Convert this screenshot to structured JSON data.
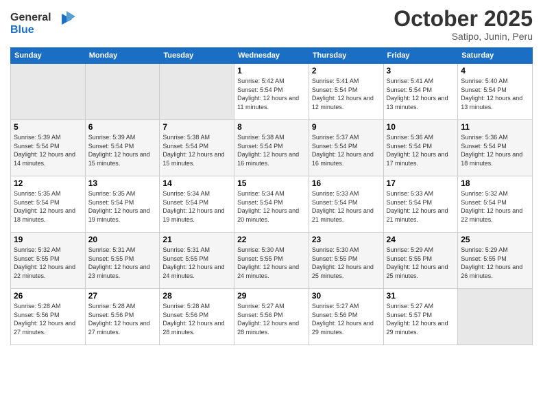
{
  "header": {
    "logo_line1": "General",
    "logo_line2": "Blue",
    "month_title": "October 2025",
    "location": "Satipo, Junin, Peru"
  },
  "weekdays": [
    "Sunday",
    "Monday",
    "Tuesday",
    "Wednesday",
    "Thursday",
    "Friday",
    "Saturday"
  ],
  "weeks": [
    [
      {
        "day": "",
        "sunrise": "",
        "sunset": "",
        "daylight": ""
      },
      {
        "day": "",
        "sunrise": "",
        "sunset": "",
        "daylight": ""
      },
      {
        "day": "",
        "sunrise": "",
        "sunset": "",
        "daylight": ""
      },
      {
        "day": "1",
        "sunrise": "Sunrise: 5:42 AM",
        "sunset": "Sunset: 5:54 PM",
        "daylight": "Daylight: 12 hours and 11 minutes."
      },
      {
        "day": "2",
        "sunrise": "Sunrise: 5:41 AM",
        "sunset": "Sunset: 5:54 PM",
        "daylight": "Daylight: 12 hours and 12 minutes."
      },
      {
        "day": "3",
        "sunrise": "Sunrise: 5:41 AM",
        "sunset": "Sunset: 5:54 PM",
        "daylight": "Daylight: 12 hours and 13 minutes."
      },
      {
        "day": "4",
        "sunrise": "Sunrise: 5:40 AM",
        "sunset": "Sunset: 5:54 PM",
        "daylight": "Daylight: 12 hours and 13 minutes."
      }
    ],
    [
      {
        "day": "5",
        "sunrise": "Sunrise: 5:39 AM",
        "sunset": "Sunset: 5:54 PM",
        "daylight": "Daylight: 12 hours and 14 minutes."
      },
      {
        "day": "6",
        "sunrise": "Sunrise: 5:39 AM",
        "sunset": "Sunset: 5:54 PM",
        "daylight": "Daylight: 12 hours and 15 minutes."
      },
      {
        "day": "7",
        "sunrise": "Sunrise: 5:38 AM",
        "sunset": "Sunset: 5:54 PM",
        "daylight": "Daylight: 12 hours and 15 minutes."
      },
      {
        "day": "8",
        "sunrise": "Sunrise: 5:38 AM",
        "sunset": "Sunset: 5:54 PM",
        "daylight": "Daylight: 12 hours and 16 minutes."
      },
      {
        "day": "9",
        "sunrise": "Sunrise: 5:37 AM",
        "sunset": "Sunset: 5:54 PM",
        "daylight": "Daylight: 12 hours and 16 minutes."
      },
      {
        "day": "10",
        "sunrise": "Sunrise: 5:36 AM",
        "sunset": "Sunset: 5:54 PM",
        "daylight": "Daylight: 12 hours and 17 minutes."
      },
      {
        "day": "11",
        "sunrise": "Sunrise: 5:36 AM",
        "sunset": "Sunset: 5:54 PM",
        "daylight": "Daylight: 12 hours and 18 minutes."
      }
    ],
    [
      {
        "day": "12",
        "sunrise": "Sunrise: 5:35 AM",
        "sunset": "Sunset: 5:54 PM",
        "daylight": "Daylight: 12 hours and 18 minutes."
      },
      {
        "day": "13",
        "sunrise": "Sunrise: 5:35 AM",
        "sunset": "Sunset: 5:54 PM",
        "daylight": "Daylight: 12 hours and 19 minutes."
      },
      {
        "day": "14",
        "sunrise": "Sunrise: 5:34 AM",
        "sunset": "Sunset: 5:54 PM",
        "daylight": "Daylight: 12 hours and 19 minutes."
      },
      {
        "day": "15",
        "sunrise": "Sunrise: 5:34 AM",
        "sunset": "Sunset: 5:54 PM",
        "daylight": "Daylight: 12 hours and 20 minutes."
      },
      {
        "day": "16",
        "sunrise": "Sunrise: 5:33 AM",
        "sunset": "Sunset: 5:54 PM",
        "daylight": "Daylight: 12 hours and 21 minutes."
      },
      {
        "day": "17",
        "sunrise": "Sunrise: 5:33 AM",
        "sunset": "Sunset: 5:54 PM",
        "daylight": "Daylight: 12 hours and 21 minutes."
      },
      {
        "day": "18",
        "sunrise": "Sunrise: 5:32 AM",
        "sunset": "Sunset: 5:54 PM",
        "daylight": "Daylight: 12 hours and 22 minutes."
      }
    ],
    [
      {
        "day": "19",
        "sunrise": "Sunrise: 5:32 AM",
        "sunset": "Sunset: 5:55 PM",
        "daylight": "Daylight: 12 hours and 22 minutes."
      },
      {
        "day": "20",
        "sunrise": "Sunrise: 5:31 AM",
        "sunset": "Sunset: 5:55 PM",
        "daylight": "Daylight: 12 hours and 23 minutes."
      },
      {
        "day": "21",
        "sunrise": "Sunrise: 5:31 AM",
        "sunset": "Sunset: 5:55 PM",
        "daylight": "Daylight: 12 hours and 24 minutes."
      },
      {
        "day": "22",
        "sunrise": "Sunrise: 5:30 AM",
        "sunset": "Sunset: 5:55 PM",
        "daylight": "Daylight: 12 hours and 24 minutes."
      },
      {
        "day": "23",
        "sunrise": "Sunrise: 5:30 AM",
        "sunset": "Sunset: 5:55 PM",
        "daylight": "Daylight: 12 hours and 25 minutes."
      },
      {
        "day": "24",
        "sunrise": "Sunrise: 5:29 AM",
        "sunset": "Sunset: 5:55 PM",
        "daylight": "Daylight: 12 hours and 25 minutes."
      },
      {
        "day": "25",
        "sunrise": "Sunrise: 5:29 AM",
        "sunset": "Sunset: 5:55 PM",
        "daylight": "Daylight: 12 hours and 26 minutes."
      }
    ],
    [
      {
        "day": "26",
        "sunrise": "Sunrise: 5:28 AM",
        "sunset": "Sunset: 5:56 PM",
        "daylight": "Daylight: 12 hours and 27 minutes."
      },
      {
        "day": "27",
        "sunrise": "Sunrise: 5:28 AM",
        "sunset": "Sunset: 5:56 PM",
        "daylight": "Daylight: 12 hours and 27 minutes."
      },
      {
        "day": "28",
        "sunrise": "Sunrise: 5:28 AM",
        "sunset": "Sunset: 5:56 PM",
        "daylight": "Daylight: 12 hours and 28 minutes."
      },
      {
        "day": "29",
        "sunrise": "Sunrise: 5:27 AM",
        "sunset": "Sunset: 5:56 PM",
        "daylight": "Daylight: 12 hours and 28 minutes."
      },
      {
        "day": "30",
        "sunrise": "Sunrise: 5:27 AM",
        "sunset": "Sunset: 5:56 PM",
        "daylight": "Daylight: 12 hours and 29 minutes."
      },
      {
        "day": "31",
        "sunrise": "Sunrise: 5:27 AM",
        "sunset": "Sunset: 5:57 PM",
        "daylight": "Daylight: 12 hours and 29 minutes."
      },
      {
        "day": "",
        "sunrise": "",
        "sunset": "",
        "daylight": ""
      }
    ]
  ]
}
